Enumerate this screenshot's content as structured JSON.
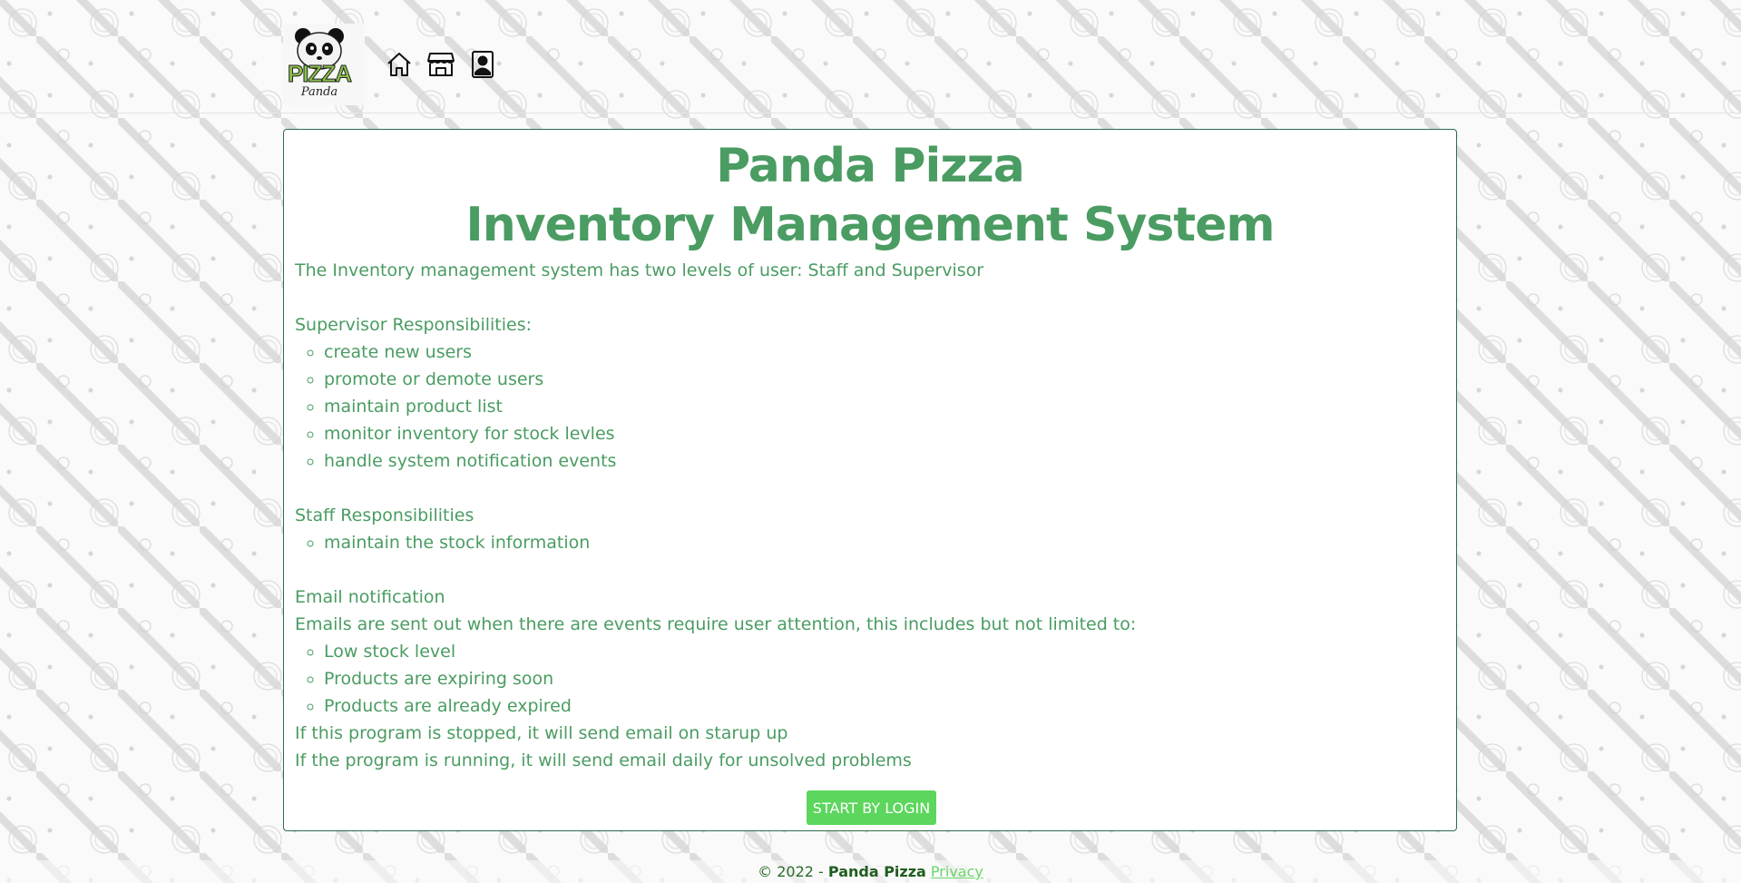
{
  "nav": {
    "logo": {
      "text": "PIZZA",
      "subtext": "Panda"
    },
    "icons": [
      "home-icon",
      "store-icon",
      "contact-card-icon"
    ]
  },
  "main": {
    "title_line1": "Panda Pizza",
    "title_line2": "Inventory Management System",
    "intro": "The Inventory management system has two levels of user: Staff and Supervisor",
    "supervisor_heading": "Supervisor Responsibilities:",
    "supervisor_items": [
      "create new users",
      "promote or demote users",
      "maintain product list",
      "monitor inventory for stock levles",
      "handle system notification events"
    ],
    "staff_heading": "Staff Responsibilities",
    "staff_items": [
      "maintain the stock information"
    ],
    "email_heading": "Email notification",
    "email_intro": "Emails are sent out when there are events require user attention, this includes but not limited to:",
    "email_items": [
      "Low stock level",
      "Products are expiring soon",
      "Products are already expired"
    ],
    "note_stopped": "If this program is stopped, it will send email on starup up",
    "note_running": "If the program is running, it will send email daily for unsolved problems",
    "login_button": "START BY LOGIN"
  },
  "footer": {
    "copyright": "© 2022 -",
    "brand": "Panda Pizza",
    "privacy_link": "Privacy"
  },
  "colors": {
    "accent_text": "#4a9c62",
    "button": "#5cd65c",
    "card_border": "#2f6b4f"
  }
}
